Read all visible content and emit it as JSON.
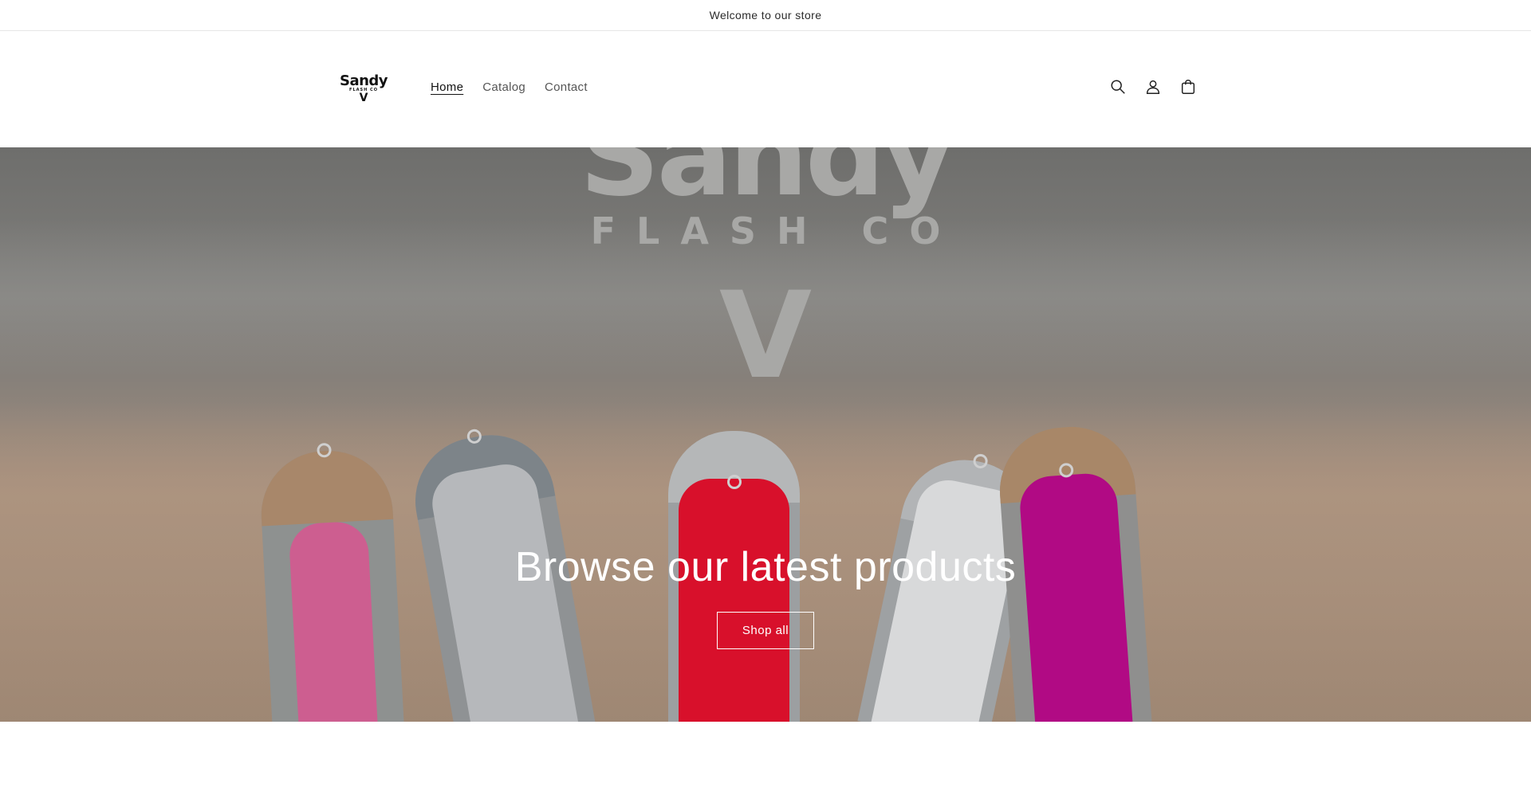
{
  "announcement": {
    "text": "Welcome to our store"
  },
  "header": {
    "logo": {
      "line1": "Sandy",
      "line2": "FLASH CO",
      "line3": "V"
    },
    "nav": [
      {
        "label": "Home",
        "active": true
      },
      {
        "label": "Catalog",
        "active": false
      },
      {
        "label": "Contact",
        "active": false
      }
    ],
    "icons": [
      "search-icon",
      "account-icon",
      "cart-icon"
    ]
  },
  "hero": {
    "background_text": {
      "line1": "Sandy",
      "line2": "FLASH CO",
      "line3": "V"
    },
    "title": "Browse our latest products",
    "button_label": "Shop all"
  },
  "colors": {
    "text": "#121212",
    "nav_inactive": "#555555",
    "hero_text": "#ffffff",
    "lure_pink": "#e2337a",
    "lure_red": "#d8102b",
    "lure_magenta": "#b10a84"
  }
}
